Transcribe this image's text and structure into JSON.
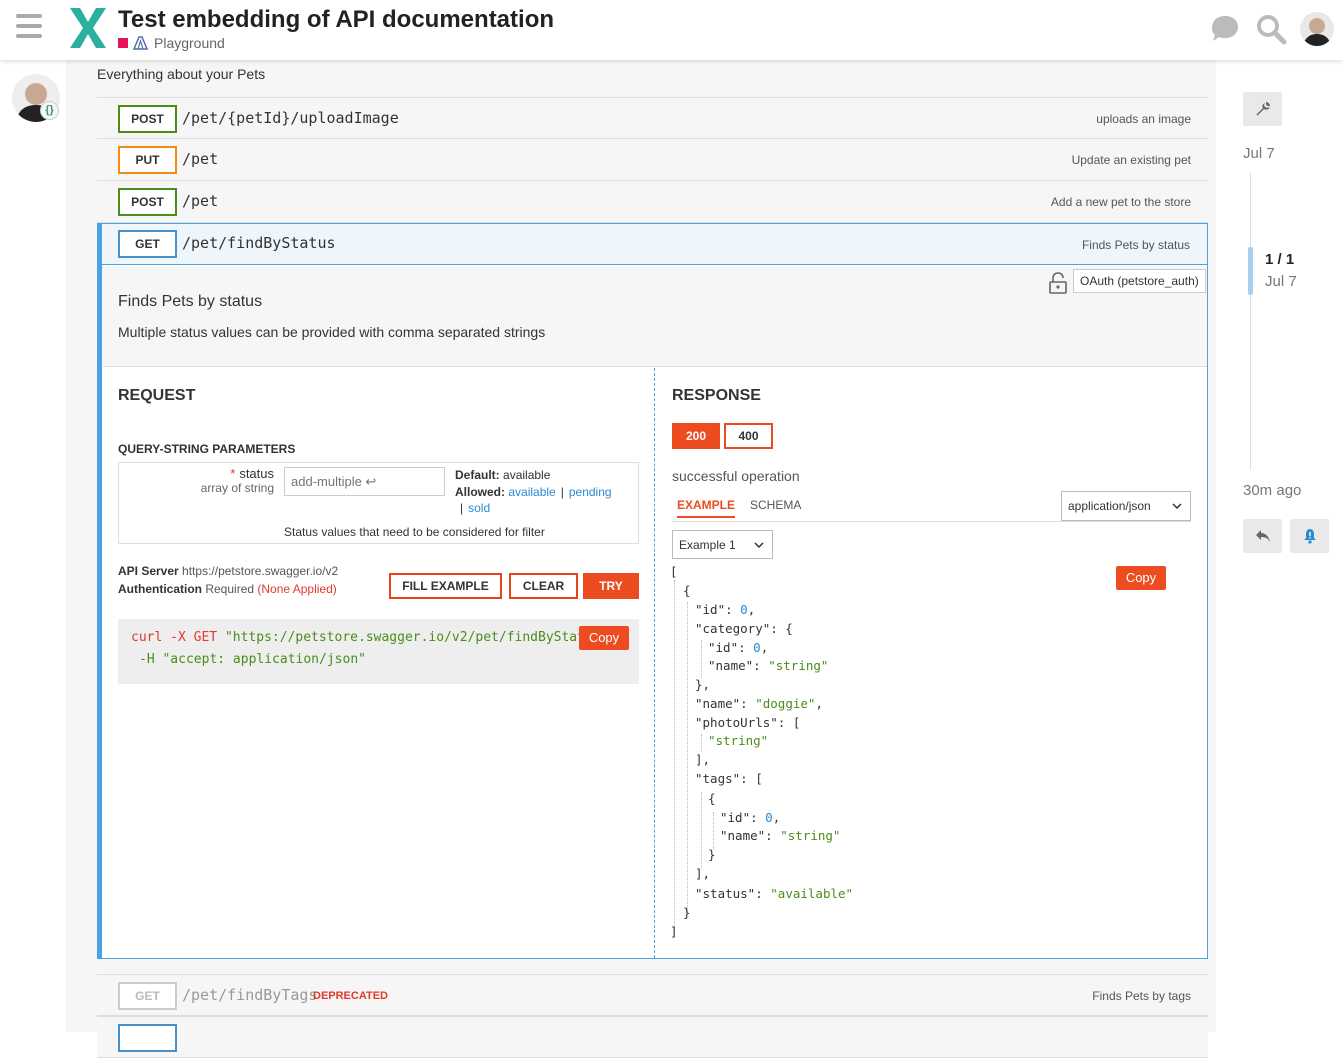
{
  "header": {
    "title": "Test embedding of API documentation",
    "category": "Playground",
    "category_color": "#e4135b"
  },
  "section": {
    "description": "Everything about your Pets"
  },
  "operations": [
    {
      "method": "POST",
      "path": "/pet/{petId}/uploadImage",
      "summary": "uploads an image"
    },
    {
      "method": "PUT",
      "path": "/pet",
      "summary": "Update an existing pet"
    },
    {
      "method": "POST",
      "path": "/pet",
      "summary": "Add a new pet to the store"
    },
    {
      "method": "GET",
      "path": "/pet/findByStatus",
      "summary": "Finds Pets by status"
    },
    {
      "method": "GET",
      "path": "/pet/findByTags",
      "summary": "Finds Pets by tags",
      "tag": "DEPRECATED"
    }
  ],
  "expanded": {
    "auth_badge": "OAuth (petstore_auth)",
    "title": "Finds Pets by status",
    "description": "Multiple status values can be provided with comma separated strings",
    "request": {
      "title": "REQUEST",
      "query_title": "QUERY-STRING PARAMETERS",
      "param": {
        "required_mark": "*",
        "name": "status",
        "type": "array of string",
        "placeholder": "add-multiple ↩",
        "default_label": "Default:",
        "default_value": "available",
        "allowed_label": "Allowed:",
        "allowed": [
          "available",
          "pending",
          "sold"
        ],
        "separator": "|",
        "hint": "Status values that need to be considered for filter"
      },
      "api_server_label": "API Server",
      "api_server": "https://petstore.swagger.io/v2",
      "auth_label": "Authentication",
      "auth_required": "Required",
      "auth_status": "(None Applied)",
      "fill_example": "FILL EXAMPLE",
      "clear": "CLEAR",
      "try": "TRY",
      "curl_cmd": "curl",
      "curl_flag1": "-X GET",
      "curl_url": "\"https://petstore.swagger.io/v2/pet/findByStatus\"",
      "curl_line2": "-H \"accept: application/json\"",
      "copy": "Copy"
    },
    "response": {
      "title": "RESPONSE",
      "codes": [
        "200",
        "400"
      ],
      "active_code": "200",
      "description": "successful operation",
      "tabs": [
        "EXAMPLE",
        "SCHEMA"
      ],
      "media_type": "application/json",
      "example_select": "Example 1",
      "copy": "Copy"
    }
  },
  "timeline": {
    "date_top": "Jul 7",
    "count": "1 / 1",
    "date_current": "Jul 7",
    "ago": "30m ago"
  },
  "colors": {
    "accent": "#ec4c1f",
    "post": "#4a8d1a",
    "put": "#f18e12",
    "get": "#4a90c8",
    "link": "#2b8ad1"
  }
}
